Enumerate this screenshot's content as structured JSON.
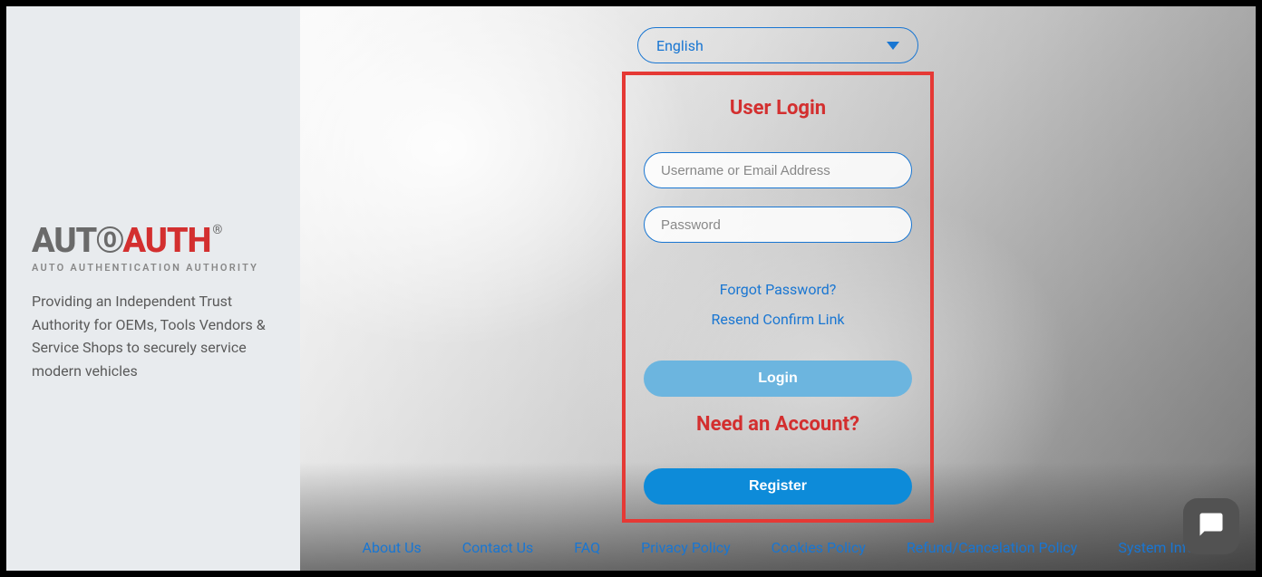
{
  "left": {
    "logo": {
      "part1": "AUT",
      "part2": "AUTH",
      "subtitle": "AUTO AUTHENTICATION AUTHORITY"
    },
    "tagline": "Providing an Independent Trust Authority for OEMs, Tools Vendors & Service Shops to securely service modern vehicles"
  },
  "language": {
    "selected": "English"
  },
  "login": {
    "title": "User Login",
    "username_placeholder": "Username or Email Address",
    "password_placeholder": "Password",
    "forgot_link": "Forgot Password?",
    "resend_link": "Resend Confirm Link",
    "login_button": "Login",
    "need_account": "Need an Account?",
    "register_button": "Register"
  },
  "footer": {
    "links": {
      "about": "About Us",
      "contact": "Contact Us",
      "faq": "FAQ",
      "privacy": "Privacy Policy",
      "cookies": "Cookies Policy",
      "refund": "Refund/Cancelation Policy",
      "system": "System Informa"
    }
  }
}
